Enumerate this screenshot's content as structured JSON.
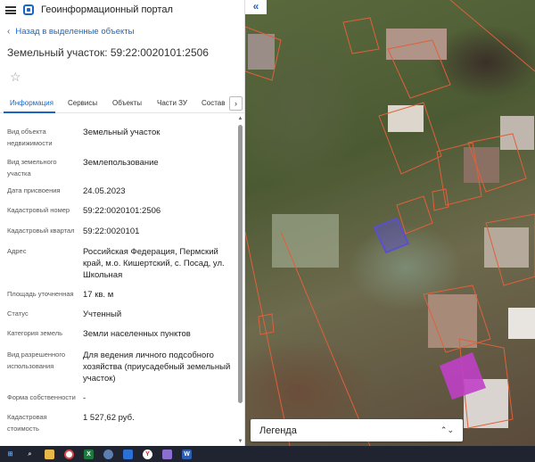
{
  "app": {
    "title": "Геоинформационный портал"
  },
  "nav": {
    "back_label": "Назад в выделенные объекты"
  },
  "object": {
    "title": "Земельный участок: 59:22:0020101:2506"
  },
  "tabs": [
    {
      "label": "Информация",
      "active": true
    },
    {
      "label": "Сервисы"
    },
    {
      "label": "Объекты"
    },
    {
      "label": "Части ЗУ"
    },
    {
      "label": "Состав"
    }
  ],
  "info_rows": [
    {
      "label": "Вид объекта недвижимости",
      "value": "Земельный участок"
    },
    {
      "label": "Вид земельного участка",
      "value": "Землепользование"
    },
    {
      "label": "Дата присвоения",
      "value": "24.05.2023"
    },
    {
      "label": "Кадастровый номер",
      "value": "59:22:0020101:2506"
    },
    {
      "label": "Кадастровый квартал",
      "value": "59:22:0020101"
    },
    {
      "label": "Адрес",
      "value": "Российская Федерация, Пермский край, м.о. Кишертский, с. Посад, ул. Школьная"
    },
    {
      "label": "Площадь уточненная",
      "value": "17 кв. м"
    },
    {
      "label": "Статус",
      "value": "Учтенный"
    },
    {
      "label": "Категория земель",
      "value": "Земли населенных пунктов"
    },
    {
      "label": "Вид разрешенного использования",
      "value": "Для ведения личного подсобного хозяйства (приусадебный земельный участок)"
    },
    {
      "label": "Форма собственности",
      "value": "-"
    },
    {
      "label": "Кадастровая стоимость",
      "value": "1 527,62 руб."
    }
  ],
  "map": {
    "collapse_icon": "«",
    "legend_label": "Легенда",
    "legend_icon": "chevron-updown-icon"
  },
  "colors": {
    "accent": "#1a66c7",
    "parcel_border": "#e0603a",
    "selected_parcel": "#5a4fd0",
    "highlight_parcel": "#c040c8"
  },
  "taskbar": {
    "icons": [
      "windows-start-icon",
      "search-icon",
      "file-explorer-icon",
      "chrome-icon",
      "excel-icon",
      "app-icon",
      "app-icon",
      "yandex-icon",
      "app-icon",
      "word-icon"
    ]
  }
}
